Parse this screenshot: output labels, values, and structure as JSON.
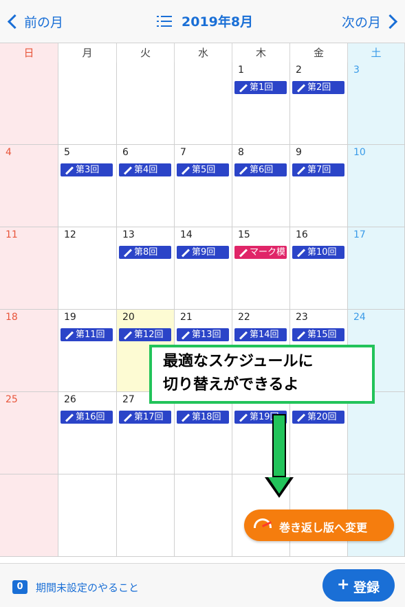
{
  "header": {
    "prev_label": "前の月",
    "next_label": "次の月",
    "month_title": "2019年8月",
    "icons": [
      "chevron-left-icon",
      "list-icon",
      "chevron-right-icon"
    ]
  },
  "weekdays": [
    "日",
    "月",
    "火",
    "水",
    "木",
    "金",
    "土"
  ],
  "weeks": [
    [
      {
        "d": ""
      },
      {
        "d": ""
      },
      {
        "d": ""
      },
      {
        "d": ""
      },
      {
        "d": "1",
        "ev": "第1回"
      },
      {
        "d": "2",
        "ev": "第2回"
      },
      {
        "d": "3"
      }
    ],
    [
      {
        "d": "4"
      },
      {
        "d": "5",
        "ev": "第3回"
      },
      {
        "d": "6",
        "ev": "第4回"
      },
      {
        "d": "7",
        "ev": "第5回"
      },
      {
        "d": "8",
        "ev": "第6回"
      },
      {
        "d": "9",
        "ev": "第7回"
      },
      {
        "d": "10"
      }
    ],
    [
      {
        "d": "11"
      },
      {
        "d": "12"
      },
      {
        "d": "13",
        "ev": "第8回"
      },
      {
        "d": "14",
        "ev": "第9回"
      },
      {
        "d": "15",
        "ev": "マーク模",
        "pink": true
      },
      {
        "d": "16",
        "ev": "第10回"
      },
      {
        "d": "17"
      }
    ],
    [
      {
        "d": "18"
      },
      {
        "d": "19",
        "ev": "第11回"
      },
      {
        "d": "20",
        "ev": "第12回",
        "today": true
      },
      {
        "d": "21",
        "ev": "第13回"
      },
      {
        "d": "22",
        "ev": "第14回"
      },
      {
        "d": "23",
        "ev": "第15回"
      },
      {
        "d": "24"
      }
    ],
    [
      {
        "d": "25"
      },
      {
        "d": "26",
        "ev": "第16回"
      },
      {
        "d": "27",
        "ev": "第17回"
      },
      {
        "d": "",
        "ev": "第18回"
      },
      {
        "d": "",
        "ev": "第19回"
      },
      {
        "d": "",
        "ev": "第20回"
      },
      {
        "d": ""
      }
    ],
    [
      {
        "d": ""
      },
      {
        "d": ""
      },
      {
        "d": ""
      },
      {
        "d": ""
      },
      {
        "d": ""
      },
      {
        "d": ""
      },
      {
        "d": ""
      }
    ]
  ],
  "callout": {
    "line1": "最適なスケジュールに",
    "line2": "切り替えができるよ"
  },
  "rewind_button": {
    "label": "巻き返し版へ変更"
  },
  "footer": {
    "todo_count": "0",
    "todo_label": "期間未設定のやること",
    "register_plus": "+",
    "register_label": "登録"
  },
  "colors": {
    "accent": "#1a6fd6",
    "event": "#2b44c8",
    "event_pink": "#e02568",
    "sunday_bg": "#fde9eb",
    "saturday_bg": "#e4f6fb",
    "today_bg": "#fdfbd3",
    "rewind_orange": "#f57d0e",
    "callout_green": "#22c35a"
  }
}
